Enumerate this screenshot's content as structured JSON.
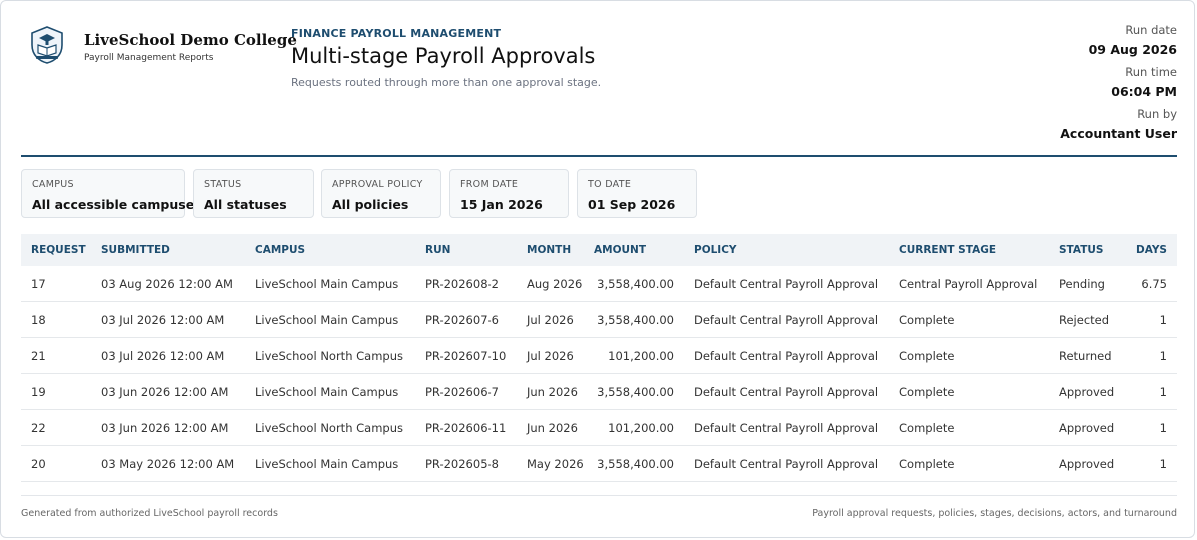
{
  "org": {
    "name": "LiveSchool Demo College",
    "subtitle": "Payroll Management Reports"
  },
  "report": {
    "kicker": "FINANCE PAYROLL MANAGEMENT",
    "title": "Multi-stage Payroll Approvals",
    "subtitle": "Requests routed through more than one approval stage."
  },
  "meta": {
    "run_date_label": "Run date",
    "run_date": "09 Aug 2026",
    "run_time_label": "Run time",
    "run_time": "06:04 PM",
    "run_by_label": "Run by",
    "run_by": "Accountant User"
  },
  "filters": [
    {
      "label": "CAMPUS",
      "value": "All accessible campuses"
    },
    {
      "label": "STATUS",
      "value": "All statuses"
    },
    {
      "label": "APPROVAL POLICY",
      "value": "All policies"
    },
    {
      "label": "FROM DATE",
      "value": "15 Jan 2026"
    },
    {
      "label": "TO DATE",
      "value": "01 Sep 2026"
    }
  ],
  "table": {
    "columns": [
      "REQUEST",
      "SUBMITTED",
      "CAMPUS",
      "RUN",
      "MONTH",
      "AMOUNT",
      "POLICY",
      "CURRENT STAGE",
      "STATUS",
      "DAYS"
    ],
    "rows": [
      [
        "17",
        "03 Aug 2026 12:00 AM",
        "LiveSchool Main Campus",
        "PR-202608-2",
        "Aug 2026",
        "3,558,400.00",
        "Default Central Payroll Approval",
        "Central Payroll Approval",
        "Pending",
        "6.75"
      ],
      [
        "18",
        "03 Jul 2026 12:00 AM",
        "LiveSchool Main Campus",
        "PR-202607-6",
        "Jul 2026",
        "3,558,400.00",
        "Default Central Payroll Approval",
        "Complete",
        "Rejected",
        "1"
      ],
      [
        "21",
        "03 Jul 2026 12:00 AM",
        "LiveSchool North Campus",
        "PR-202607-10",
        "Jul 2026",
        "101,200.00",
        "Default Central Payroll Approval",
        "Complete",
        "Returned",
        "1"
      ],
      [
        "19",
        "03 Jun 2026 12:00 AM",
        "LiveSchool Main Campus",
        "PR-202606-7",
        "Jun 2026",
        "3,558,400.00",
        "Default Central Payroll Approval",
        "Complete",
        "Approved",
        "1"
      ],
      [
        "22",
        "03 Jun 2026 12:00 AM",
        "LiveSchool North Campus",
        "PR-202606-11",
        "Jun 2026",
        "101,200.00",
        "Default Central Payroll Approval",
        "Complete",
        "Approved",
        "1"
      ],
      [
        "20",
        "03 May 2026 12:00 AM",
        "LiveSchool Main Campus",
        "PR-202605-8",
        "May 2026",
        "3,558,400.00",
        "Default Central Payroll Approval",
        "Complete",
        "Approved",
        "1"
      ]
    ]
  },
  "footer": {
    "left": "Generated from authorized LiveSchool payroll records",
    "right": "Payroll approval requests, policies, stages, decisions, actors, and turnaround"
  },
  "colors": {
    "accent": "#1e4d6f",
    "header_row_bg": "#f0f3f6"
  },
  "icons": {
    "logo": "college-crest-logo"
  }
}
